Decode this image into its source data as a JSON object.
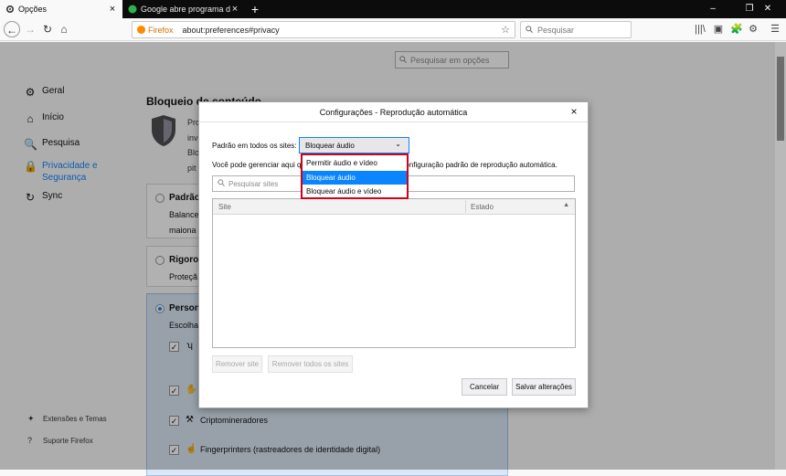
{
  "tabs": [
    {
      "title": "Opções",
      "icon": "gear-icon",
      "close": "×"
    },
    {
      "title": "Google abre programa de esta",
      "icon": "site-favicon-icon",
      "close": "×"
    }
  ],
  "tab_new": "+",
  "window": {
    "minimize": "–",
    "maximize": "❐",
    "close": "✕"
  },
  "nav": {
    "back": "←",
    "forward": "→",
    "reload": "↻",
    "home": "⌂",
    "brand": "Firefox",
    "url": "about:preferences#privacy",
    "bookmark": "☆",
    "search_placeholder": "Pesquisar",
    "toolbar_icons": [
      "|||\\",
      "▣",
      "🧩",
      "⚙",
      "☰"
    ]
  },
  "prefs": {
    "search_placeholder": "Pesquisar em opções",
    "sidebar": [
      {
        "label": "Geral",
        "icon": "⚙"
      },
      {
        "label": "Início",
        "icon": "⌂"
      },
      {
        "label": "Pesquisa",
        "icon": "🔍"
      },
      {
        "label": "Privacidade e Segurança",
        "icon": "🔒"
      },
      {
        "label": "Sync",
        "icon": "↻"
      }
    ],
    "sidebar_footer": [
      {
        "label": "Extensões e Temas",
        "icon": "✦"
      },
      {
        "label": "Suporte Firefox",
        "icon": "?"
      }
    ],
    "section_title": "Bloqueio de conteúdo",
    "intro_fragments": [
      "Pro",
      "inv",
      "Blo",
      "pit"
    ],
    "options": [
      {
        "title": "Padrão",
        "desc_lines": [
          "Balance",
          "maiona"
        ]
      },
      {
        "title": "Rigoros",
        "desc_lines": [
          "Proteçã"
        ]
      },
      {
        "title": "Persona",
        "desc_lines": [
          "Escolha"
        ]
      }
    ],
    "custom_rows": [
      {
        "icon": "ʮ",
        "label": ""
      },
      {
        "icon": "✋",
        "label": ""
      },
      {
        "icon": "⚒",
        "label": "Criptomineradores"
      },
      {
        "icon": "☝",
        "label": "Fingerprinters (rastreadores de identidade digital)"
      }
    ],
    "checkmark": "✓"
  },
  "dialog": {
    "title": "Configurações - Reprodução automática",
    "close": "×",
    "default_label": "Padrão em todos os sites:",
    "select_value": "Bloquear áudio",
    "select_chevron": "⌄",
    "desc_left": "Você pode gerenciar aqui q",
    "desc_right": "configuração padrão de reprodução automática.",
    "search_placeholder": "Pesquisar sites",
    "columns": [
      "Site",
      "Estado"
    ],
    "sort_arrow": "▲",
    "remove_site": "Remover site",
    "remove_all": "Remover todos os sites",
    "cancel": "Cancelar",
    "save": "Salvar alterações"
  },
  "dropdown": {
    "options": [
      "Permitir áudio e vídeo",
      "Bloquear áudio",
      "Bloquear áudio e vídeo"
    ],
    "selected_index": 1
  },
  "colors": {
    "accent": "#0a84ff",
    "highlight_border": "#d0021b"
  }
}
